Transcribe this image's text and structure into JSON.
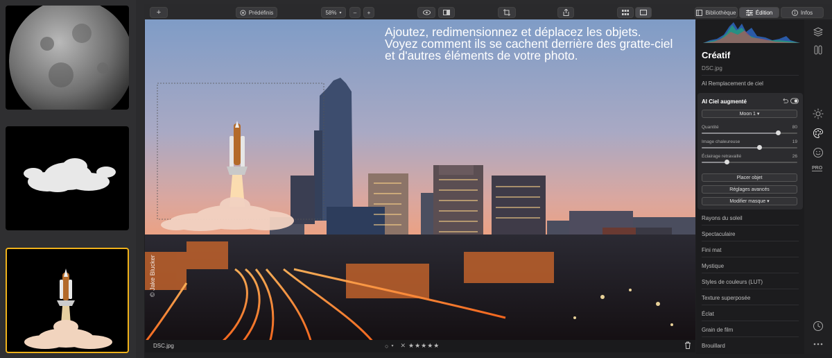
{
  "toolbar": {
    "add_label": "+",
    "presets_label": "Prédéfinis",
    "zoom_label": "58%",
    "zoom_out_label": "–",
    "zoom_in_label": "+",
    "library_label": "Bibliothèque",
    "edit_label": "Édition",
    "info_label": "Infos"
  },
  "photo": {
    "caption_line1": "Ajoutez, redimensionnez et déplacez les objets.",
    "caption_line2": "Voyez comment ils se cachent derrière des gratte-ciel",
    "caption_line3": "et d'autres éléments de votre photo.",
    "credit": "© Jake Blucker",
    "filename": "DSC.jpg",
    "stars": "★★★★★",
    "reject_mark": "✕"
  },
  "panel": {
    "title": "Créatif",
    "filename": "DSC.jpg",
    "ai_sky_replacement": "AI Remplacement de ciel",
    "card": {
      "title": "AI Ciel augmenté",
      "object_select": "Moon 1 ▾",
      "sliders": [
        {
          "label": "Quantité",
          "value": 80,
          "fraction": 0.8
        },
        {
          "label": "Image chaleureuse",
          "value": 19,
          "fraction": 0.6
        },
        {
          "label": "Éclairage retravaillé",
          "value": 26,
          "fraction": 0.26
        }
      ],
      "place_object": "Placer objet",
      "advanced_settings": "Réglages avancés",
      "edit_mask": "Modifier masque ▾"
    },
    "tools": [
      "Rayons du soleil",
      "Spectaculaire",
      "Fini mat",
      "Mystique",
      "Styles de couleurs (LUT)",
      "Texture superposée",
      "Éclat",
      "Grain de film",
      "Brouillard"
    ]
  },
  "rail": {
    "pro_label": "PRO"
  },
  "colors": {
    "accent_selection": "#f0b21a",
    "sky_top": "#7f9cc6",
    "sky_bottom": "#f0a07c"
  },
  "icons": [
    "add-icon",
    "presets-icon",
    "eye-icon",
    "compare-icon",
    "crop-icon",
    "share-icon",
    "grid-view-icon",
    "single-view-icon",
    "library-icon",
    "sliders-icon",
    "info-icon",
    "layers-icon",
    "compare-panel-icon",
    "sun-icon",
    "palette-icon",
    "face-icon",
    "history-icon",
    "more-icon",
    "trash-icon",
    "undo-icon",
    "toggle-icon"
  ]
}
